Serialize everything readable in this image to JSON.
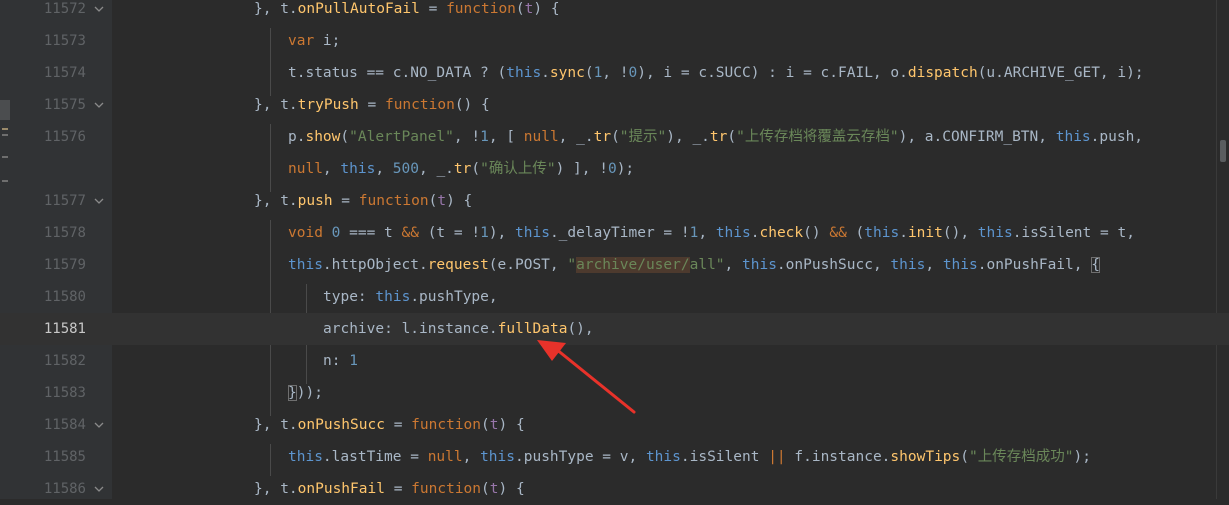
{
  "lines": [
    {
      "no": "11572",
      "fold": true,
      "code": "}, t.onPullAutoFail = function(t) {"
    },
    {
      "no": "11573",
      "fold": false,
      "code": "var i;"
    },
    {
      "no": "11574",
      "fold": false,
      "code": "t.status == c.NO_DATA ? (this.sync(1, !0), i = c.SUCC) : i = c.FAIL, o.dispatch(u.ARCHIVE_GET, i);"
    },
    {
      "no": "11575",
      "fold": true,
      "code": "}, t.tryPush = function() {"
    },
    {
      "no": "11576",
      "fold": false,
      "code": "p.show(\"AlertPanel\", !1, [ null, _.tr(\"提示\"), _.tr(\"上传存档将覆盖云存档\"), a.CONFIRM_BTN, this.push,"
    },
    {
      "no": "",
      "fold": false,
      "code": "null, this, 500, _.tr(\"确认上传\") ], !0);"
    },
    {
      "no": "11577",
      "fold": true,
      "code": "}, t.push = function(t) {"
    },
    {
      "no": "11578",
      "fold": false,
      "code": "void 0 === t && (t = !1), this._delayTimer = !1, this.check() && (this.init(), this.isSilent = t,"
    },
    {
      "no": "11579",
      "fold": false,
      "code": "this.httpObject.request(e.POST, \"archive/user/all\", this.onPushSucc, this, this.onPushFail, {"
    },
    {
      "no": "11580",
      "fold": false,
      "code": "type: this.pushType,"
    },
    {
      "no": "11581",
      "fold": false,
      "code": "archive: l.instance.fullData(),"
    },
    {
      "no": "11582",
      "fold": false,
      "code": "n: 1"
    },
    {
      "no": "11583",
      "fold": false,
      "code": "}));"
    },
    {
      "no": "11584",
      "fold": true,
      "code": "}, t.onPushSucc = function(t) {"
    },
    {
      "no": "11585",
      "fold": false,
      "code": "this.lastTime = null, this.pushType = v, this.isSilent || f.instance.showTips(\"上传存档成功\");"
    },
    {
      "no": "11586",
      "fold": true,
      "code": "}, t.onPushFail = function(t) {"
    }
  ],
  "current_line": "11581",
  "colors": {
    "background": "#2b2b2b",
    "gutter": "#313335",
    "keyword": "#cc7832",
    "function": "#ffc66d",
    "string": "#6a8759",
    "number": "#6897bb",
    "this": "#5d95cf",
    "arrow": "#e8322a"
  },
  "icons": {
    "fold": "chevron-down-icon",
    "annotation": "red-arrow-icon"
  }
}
